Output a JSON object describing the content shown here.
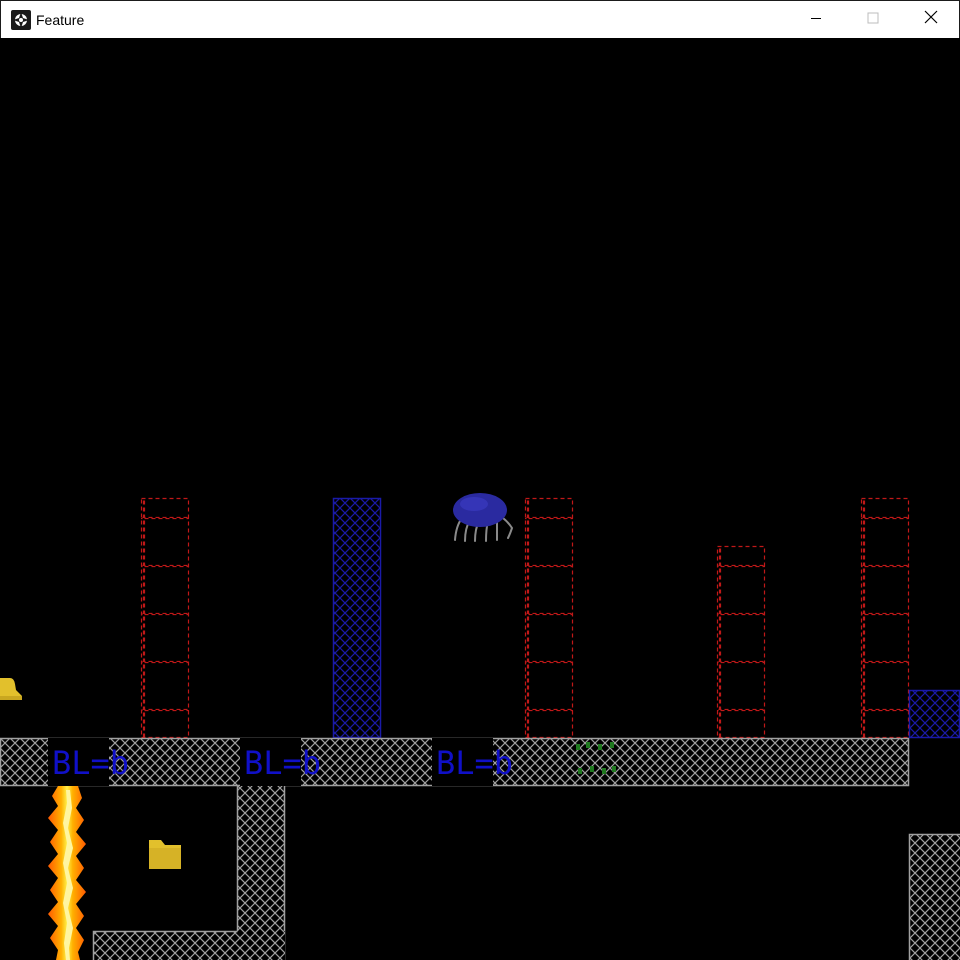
{
  "window": {
    "title": "Feature",
    "icon": "game-logo-icon",
    "controls": {
      "minimize_icon": "minimize-icon",
      "maximize_icon": "maximize-icon",
      "close_icon": "close-icon"
    }
  },
  "game": {
    "tiles": {
      "blob_text": [
        "BL=b",
        "BL=b",
        "BL=b"
      ]
    },
    "sprites": {
      "enemy": "blue-spider-creature",
      "pickup": "yellow-folder",
      "hazard": "fire-column",
      "edge_item": "yellow-bell"
    },
    "colors": {
      "background": "#000000",
      "wall": "#a0a0a0",
      "red_dashed_block": "#c01818",
      "blue_block": "#1a1aa8",
      "blob_text": "#1010c8",
      "folder": "#e2c02c",
      "fire_outer": "#ff6a00",
      "fire_inner": "#ffd800",
      "spider_body": "#2a2aa0",
      "moss": "#1f7a1f"
    }
  }
}
